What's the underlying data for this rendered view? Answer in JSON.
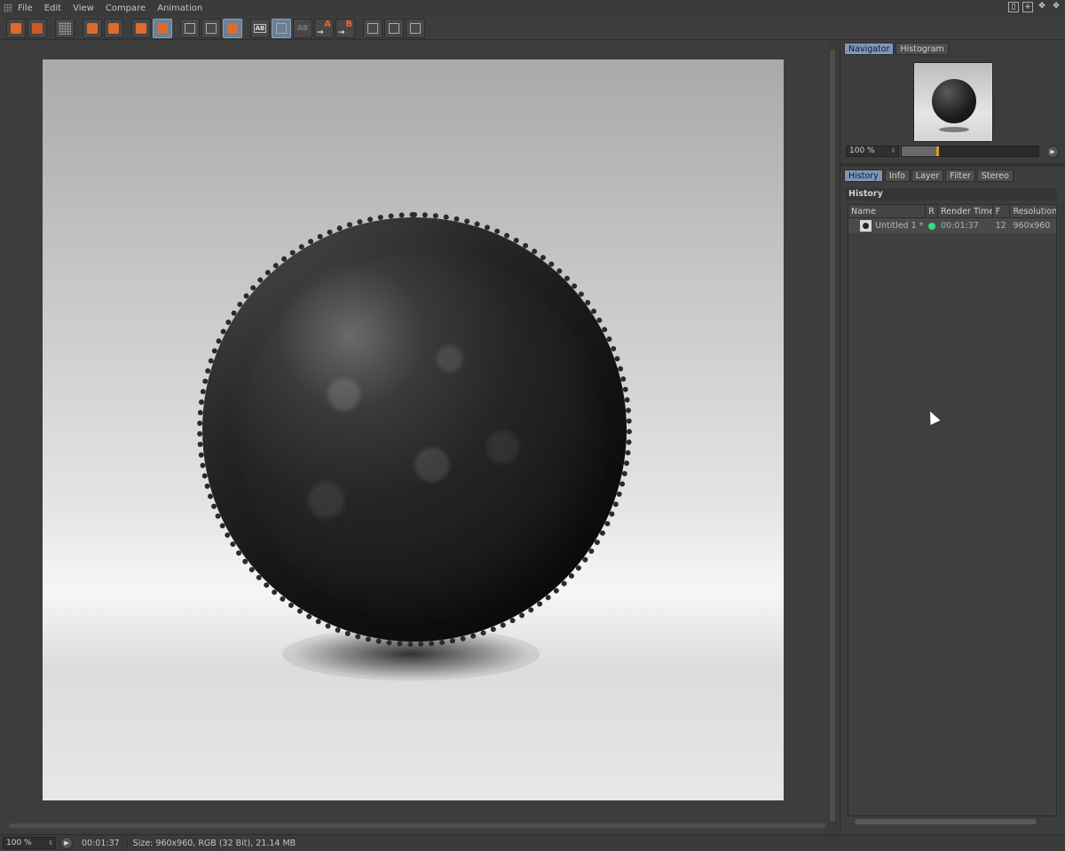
{
  "menu": {
    "items": [
      "File",
      "Edit",
      "View",
      "Compare",
      "Animation"
    ]
  },
  "toolbar": {
    "ab_label": "AB",
    "a_label": "A",
    "b_label": "B"
  },
  "navigator": {
    "tabs": [
      "Navigator",
      "Histogram"
    ],
    "zoom": "100 %",
    "slider_fraction": 0.25
  },
  "history_panel": {
    "tabs": [
      "History",
      "Info",
      "Layer",
      "Filter",
      "Stereo"
    ],
    "section_title": "History",
    "columns": [
      "Name",
      "R",
      "Render Time",
      "F",
      "Resolution"
    ],
    "rows": [
      {
        "name": "Untitled 1 *",
        "render_time": "00:01:37",
        "frames": "12",
        "resolution": "960x960",
        "status_color": "#2ee07a"
      }
    ]
  },
  "status": {
    "zoom": "100 %",
    "time": "00:01:37",
    "info": "Size: 960x960, RGB (32 Bit), 21.14 MB"
  },
  "colors": {
    "accent": "#7d97b8",
    "orange": "#e06a2c",
    "status_green": "#2ee07a"
  }
}
